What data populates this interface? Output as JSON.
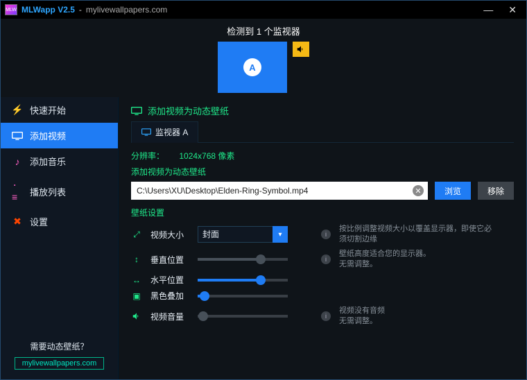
{
  "titlebar": {
    "app": "MLWapp V2.5",
    "sub": "mylivewallpapers.com"
  },
  "header": {
    "detected": "检测到 1 个监视器",
    "monitor_letter": "A"
  },
  "sidebar": {
    "items": [
      {
        "label": "快速开始"
      },
      {
        "label": "添加视频"
      },
      {
        "label": "添加音乐"
      },
      {
        "label": "播放列表"
      },
      {
        "label": "设置"
      }
    ],
    "footer_q": "需要动态壁纸？",
    "footer_link": "mylivewallpapers.com"
  },
  "content": {
    "head": "添加视频为动态壁纸",
    "tab": "监视器 A",
    "res_label": "分辨率：",
    "res_value": "1024x768 像素",
    "add_label": "添加视频为动态壁纸",
    "path": "C:\\Users\\XU\\Desktop\\Elden-Ring-Symbol.mp4",
    "browse": "浏览",
    "remove": "移除",
    "settings_head": "壁纸设置",
    "rows": {
      "size": {
        "label": "视频大小",
        "value": "封面",
        "hint": "按比例调整视频大小以覆盖显示器，即使它必须切割边缘"
      },
      "vpos": {
        "label": "垂直位置",
        "hint1": "壁纸高度适合您的显示器。",
        "hint2": "无需调整。"
      },
      "hpos": {
        "label": "水平位置"
      },
      "overlay": {
        "label": "黑色叠加"
      },
      "vol": {
        "label": "视频音量",
        "hint1": "视频没有音频",
        "hint2": "无需调整。"
      }
    }
  }
}
